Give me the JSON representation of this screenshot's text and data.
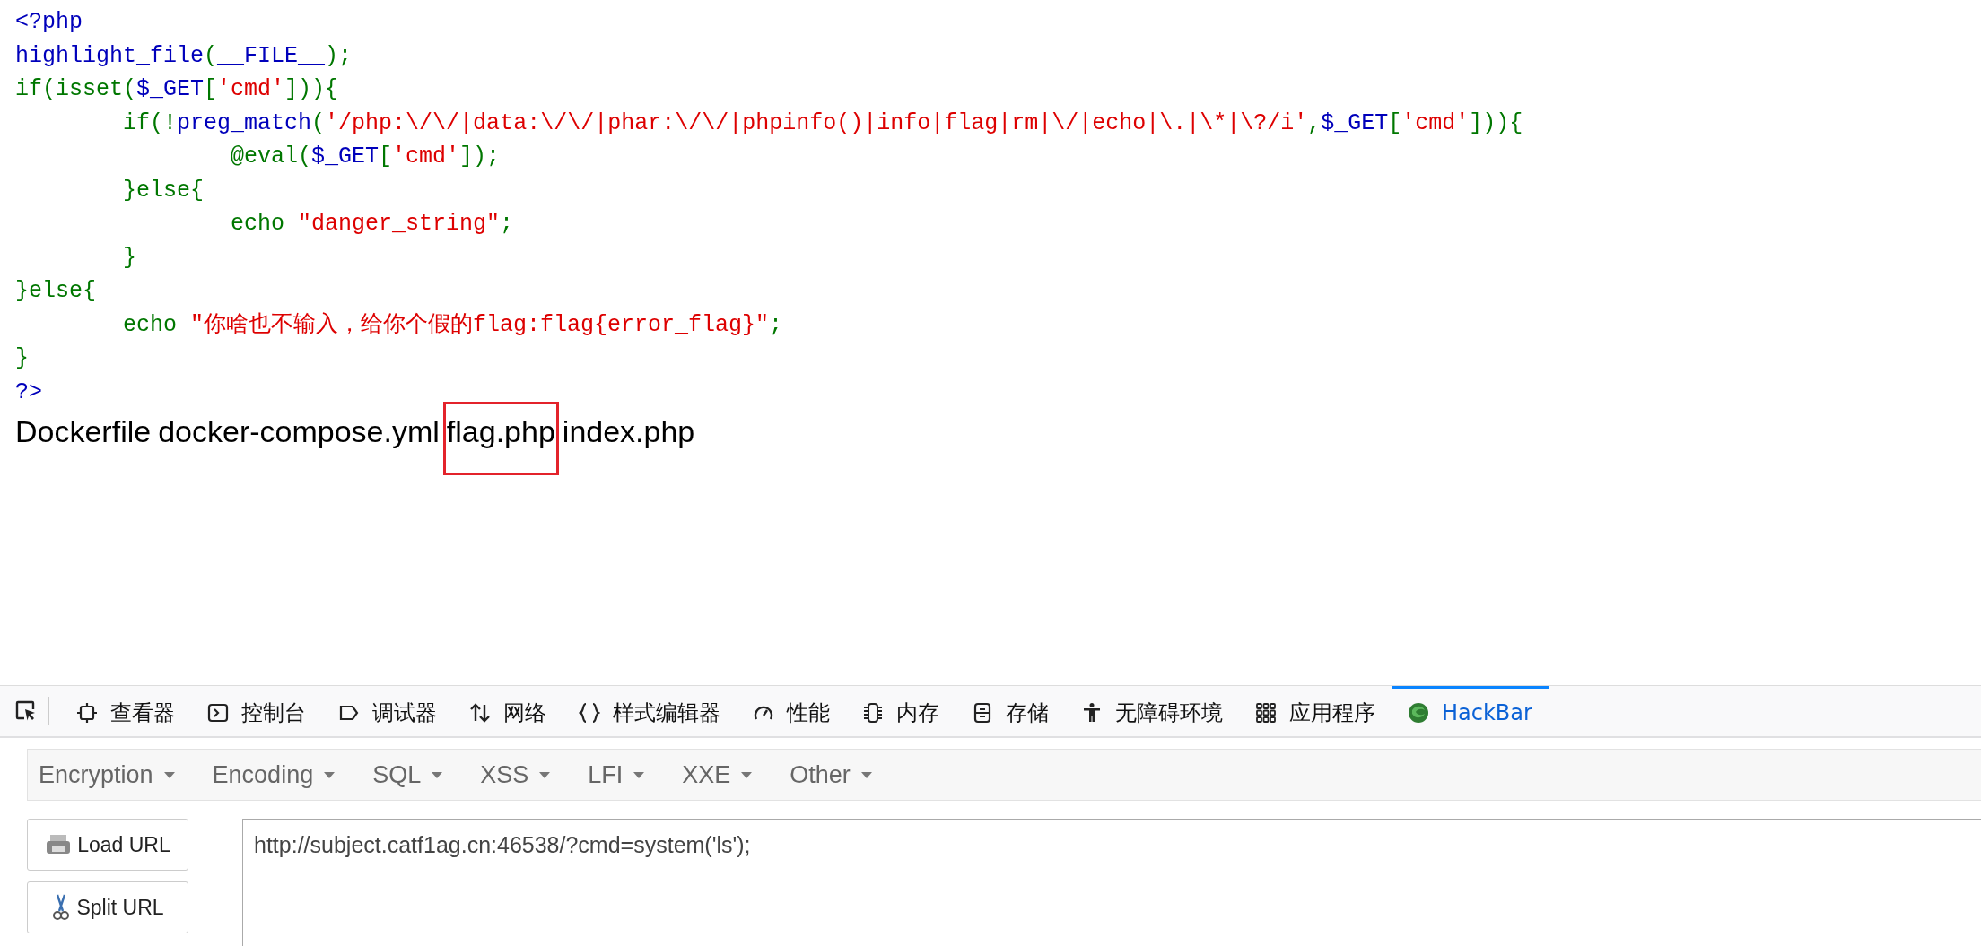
{
  "code": {
    "lines": [
      [
        {
          "kind": "default",
          "text": "<?php"
        }
      ],
      [
        {
          "kind": "default",
          "text": "highlight_file"
        },
        {
          "kind": "keyword",
          "text": "("
        },
        {
          "kind": "default",
          "text": "__FILE__"
        },
        {
          "kind": "keyword",
          "text": ");"
        }
      ],
      [
        {
          "kind": "keyword",
          "text": "if(isset("
        },
        {
          "kind": "default",
          "text": "$_GET"
        },
        {
          "kind": "keyword",
          "text": "["
        },
        {
          "kind": "string",
          "text": "'cmd'"
        },
        {
          "kind": "keyword",
          "text": "])){"
        }
      ],
      [
        {
          "kind": "keyword",
          "text": "\tif(!"
        },
        {
          "kind": "default",
          "text": "preg_match"
        },
        {
          "kind": "keyword",
          "text": "("
        },
        {
          "kind": "string",
          "text": "'/php:\\/\\/|data:\\/\\/|phar:\\/\\/|phpinfo()|info|flag|rm|\\/|echo|\\.|\\*|\\?/i'"
        },
        {
          "kind": "keyword",
          "text": ","
        },
        {
          "kind": "default",
          "text": "$_GET"
        },
        {
          "kind": "keyword",
          "text": "["
        },
        {
          "kind": "string",
          "text": "'cmd'"
        },
        {
          "kind": "keyword",
          "text": "])){"
        }
      ],
      [
        {
          "kind": "keyword",
          "text": "\t\t@eval("
        },
        {
          "kind": "default",
          "text": "$_GET"
        },
        {
          "kind": "keyword",
          "text": "["
        },
        {
          "kind": "string",
          "text": "'cmd'"
        },
        {
          "kind": "keyword",
          "text": "]);"
        }
      ],
      [
        {
          "kind": "keyword",
          "text": "\t}else{"
        }
      ],
      [
        {
          "kind": "keyword",
          "text": "\t\techo "
        },
        {
          "kind": "string",
          "text": "\"danger_string\""
        },
        {
          "kind": "keyword",
          "text": ";"
        }
      ],
      [
        {
          "kind": "keyword",
          "text": "\t}"
        }
      ],
      [
        {
          "kind": "keyword",
          "text": "}else{"
        }
      ],
      [
        {
          "kind": "keyword",
          "text": "\techo "
        },
        {
          "kind": "string",
          "text": "\"你啥也不输入，给你个假的flag:flag{error_flag}\""
        },
        {
          "kind": "keyword",
          "text": ";"
        }
      ],
      [
        {
          "kind": "keyword",
          "text": "}"
        }
      ],
      [
        {
          "kind": "default",
          "text": "?>"
        }
      ]
    ]
  },
  "output": {
    "files": [
      {
        "name": "Dockerfile",
        "highlighted": false
      },
      {
        "name": "docker-compose.yml",
        "highlighted": false
      },
      {
        "name": "flag.php",
        "highlighted": true
      },
      {
        "name": "index.php",
        "highlighted": false
      }
    ]
  },
  "devtools": {
    "tabs": [
      {
        "kind": "inspector",
        "label": "查看器",
        "selected": false
      },
      {
        "kind": "console",
        "label": "控制台",
        "selected": false
      },
      {
        "kind": "debugger",
        "label": "调试器",
        "selected": false
      },
      {
        "kind": "network",
        "label": "网络",
        "selected": false
      },
      {
        "kind": "style",
        "label": "样式编辑器",
        "selected": false
      },
      {
        "kind": "performance",
        "label": "性能",
        "selected": false
      },
      {
        "kind": "memory",
        "label": "内存",
        "selected": false
      },
      {
        "kind": "storage",
        "label": "存储",
        "selected": false
      },
      {
        "kind": "accessibility",
        "label": "无障碍环境",
        "selected": false
      },
      {
        "kind": "application",
        "label": "应用程序",
        "selected": false
      },
      {
        "kind": "hackbar",
        "label": "HackBar",
        "selected": true
      }
    ]
  },
  "hackbar": {
    "menus": [
      "Encryption",
      "Encoding",
      "SQL",
      "XSS",
      "LFI",
      "XXE",
      "Other"
    ],
    "buttons": [
      {
        "kind": "load",
        "label": "Load URL"
      },
      {
        "kind": "split",
        "label": "Split URL"
      }
    ],
    "url": "http://subject.catf1ag.cn:46538/?cmd=system('ls');"
  }
}
